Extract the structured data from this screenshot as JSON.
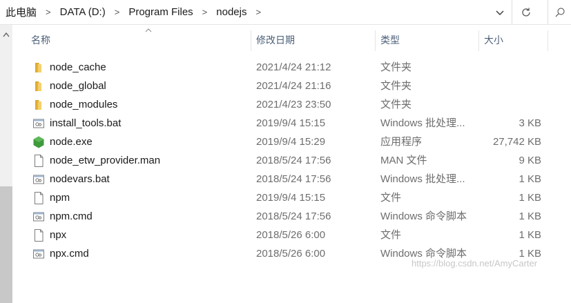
{
  "address": {
    "crumbs": [
      "此电脑",
      "DATA (D:)",
      "Program Files",
      "nodejs"
    ],
    "separator": ">",
    "search_glyph": "⚲"
  },
  "columns": {
    "name": "名称",
    "date": "修改日期",
    "type": "类型",
    "size": "大小"
  },
  "files": [
    {
      "name": "node_cache",
      "date": "2021/4/24 21:12",
      "type": "文件夹",
      "size": "",
      "icon": "folder-icon"
    },
    {
      "name": "node_global",
      "date": "2021/4/24 21:16",
      "type": "文件夹",
      "size": "",
      "icon": "folder-icon"
    },
    {
      "name": "node_modules",
      "date": "2021/4/23 23:50",
      "type": "文件夹",
      "size": "",
      "icon": "folder-icon"
    },
    {
      "name": "install_tools.bat",
      "date": "2019/9/4 15:15",
      "type": "Windows 批处理...",
      "size": "3 KB",
      "icon": "batch-file-icon"
    },
    {
      "name": "node.exe",
      "date": "2019/9/4 15:29",
      "type": "应用程序",
      "size": "27,742 KB",
      "icon": "nodejs-hexagon-icon"
    },
    {
      "name": "node_etw_provider.man",
      "date": "2018/5/24 17:56",
      "type": "MAN 文件",
      "size": "9 KB",
      "icon": "file-icon"
    },
    {
      "name": "nodevars.bat",
      "date": "2018/5/24 17:56",
      "type": "Windows 批处理...",
      "size": "1 KB",
      "icon": "batch-file-icon"
    },
    {
      "name": "npm",
      "date": "2019/9/4 15:15",
      "type": "文件",
      "size": "1 KB",
      "icon": "file-icon"
    },
    {
      "name": "npm.cmd",
      "date": "2018/5/24 17:56",
      "type": "Windows 命令脚本",
      "size": "1 KB",
      "icon": "batch-file-icon"
    },
    {
      "name": "npx",
      "date": "2018/5/26 6:00",
      "type": "文件",
      "size": "1 KB",
      "icon": "file-icon"
    },
    {
      "name": "npx.cmd",
      "date": "2018/5/26 6:00",
      "type": "Windows 命令脚本",
      "size": "1 KB",
      "icon": "batch-file-icon"
    }
  ],
  "watermark": "https://blog.csdn.net/AmyCarter",
  "colors": {
    "folder": "#f0c43f",
    "node_green": "#3f9a3c",
    "header_text": "#4c607a"
  }
}
